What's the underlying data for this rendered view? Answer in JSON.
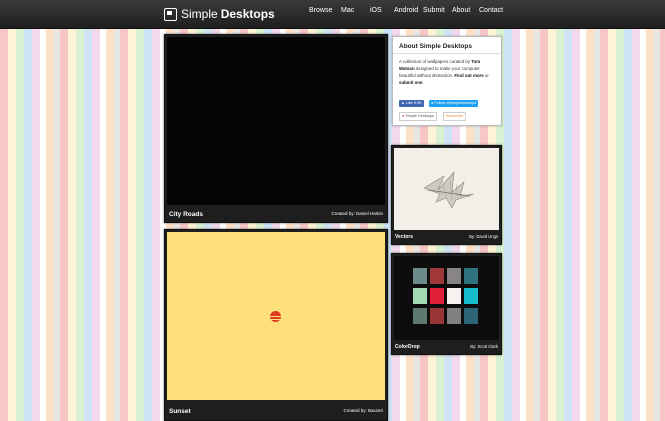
{
  "header": {
    "logo_light": "Simple",
    "logo_bold": "Desktops",
    "nav": [
      "Browse",
      "Mac",
      "iOS",
      "Android",
      "Submit",
      "About",
      "Contact"
    ]
  },
  "wallpapers": [
    {
      "title": "City Roads",
      "credit": "Created by: Daniel Harkin"
    },
    {
      "title": "Sunset",
      "credit": "Created by: Baxzeri"
    }
  ],
  "about": {
    "title": "About Simple Desktops",
    "text_1": "A collection of wallpapers curated by ",
    "author": "Tom Watson",
    "text_2": " designed to make your computer beautiful without distraction. ",
    "find_out_more": "Find out more",
    "text_3": " or ",
    "submit_one": "submit one",
    "text_4": ".",
    "like_button": "Like 9.9K",
    "follow_button": "Follow @simpledesktops",
    "source_label": "Simple Desktops",
    "subscribe_label": "Subscribe"
  },
  "sidebar_wallpapers": [
    {
      "title": "Vectors",
      "credit": "By: David Ungs"
    },
    {
      "title": "ColorDrop",
      "credit": "By: Scott Clark"
    }
  ],
  "colors": {
    "header_bg": "#262626",
    "card_bg": "#1e1e1e",
    "sunset_bg": "#fde07a",
    "sun_red": "#e23a24",
    "like_blue": "#4267b2",
    "twitter_blue": "#1da1f2"
  },
  "colordrop_palette": [
    "#6b8b8b",
    "#a03838",
    "#8a8585",
    "#2f7280",
    "#a4d9b4",
    "#e3203a",
    "#f7f2f0",
    "#18bccd",
    "#5e7a6e",
    "#9b3535",
    "#807f7f",
    "#2e6478"
  ]
}
